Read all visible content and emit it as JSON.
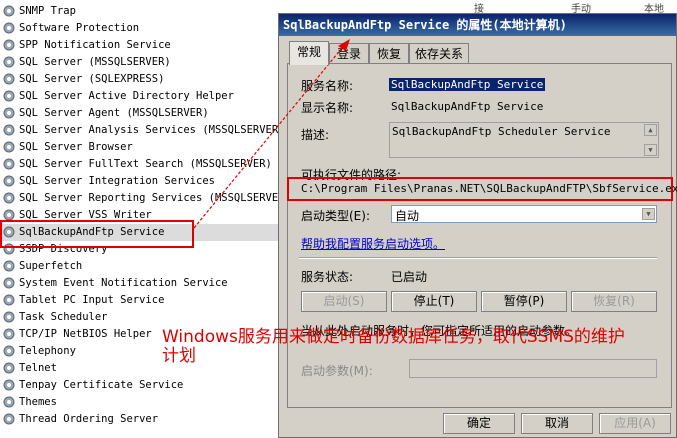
{
  "top_columns": {
    "col1": "接",
    "col2": "手动",
    "col3": "本地"
  },
  "services": [
    "SNMP Trap",
    "Software Protection",
    "SPP Notification Service",
    "SQL Server (MSSQLSERVER)",
    "SQL Server (SQLEXPRESS)",
    "SQL Server Active Directory Helper",
    "SQL Server Agent (MSSQLSERVER)",
    "SQL Server Analysis Services (MSSQLSERVER)",
    "SQL Server Browser",
    "SQL Server FullText Search (MSSQLSERVER)",
    "SQL Server Integration Services",
    "SQL Server Reporting Services (MSSQLSERVER)",
    "SQL Server VSS Writer",
    "SqlBackupAndFtp Service",
    "SSDP Discovery",
    "Superfetch",
    "System Event Notification Service",
    "Tablet PC Input Service",
    "Task Scheduler",
    "TCP/IP NetBIOS Helper",
    "Telephony",
    "Telnet",
    "Tenpay Certificate Service",
    "Themes",
    "Thread Ordering Server"
  ],
  "selected_service": "SqlBackupAndFtp Service",
  "dialog": {
    "title": "SqlBackupAndFtp Service 的属性(本地计算机)",
    "tabs": [
      "常规",
      "登录",
      "恢复",
      "依存关系"
    ],
    "labels": {
      "service_name": "服务名称:",
      "display_name": "显示名称:",
      "description": "描述:",
      "exe_path": "可执行文件的路径:",
      "startup_type": "启动类型(E):",
      "help_link": "帮助我配置服务启动选项。",
      "status": "服务状态:",
      "start_hint": "当从此处启动服务时，您可指定所适用的启动参数。",
      "start_params": "启动参数(M):"
    },
    "values": {
      "service_name": "SqlBackupAndFtp Service",
      "display_name": "SqlBackupAndFtp Service",
      "description": "SqlBackupAndFtp Scheduler Service",
      "exe_path": "C:\\Program Files\\Pranas.NET\\SQLBackupAndFTP\\SbfService.exe",
      "startup_type": "自动",
      "status": "已启动",
      "start_params": ""
    },
    "buttons": {
      "start": "启动(S)",
      "stop": "停止(T)",
      "pause": "暂停(P)",
      "resume": "恢复(R)",
      "ok": "确定",
      "cancel": "取消",
      "apply": "应用(A)"
    }
  },
  "annotation": "Windows服务用来做定时备份数据库任务，取代SSMS的维护计划",
  "colors": {
    "annotation": "#e00000",
    "titlebar": "#0a246a"
  }
}
